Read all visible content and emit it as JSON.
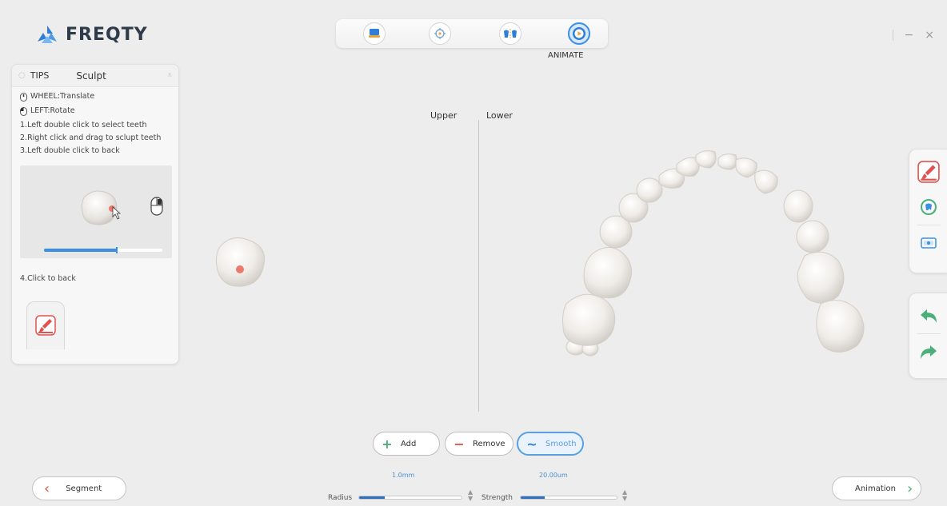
{
  "brand": {
    "name": "FREQTY",
    "color": "#2f7fd8"
  },
  "modebar": {
    "modes": [
      {
        "name": "scan-mode",
        "icon": "scanner-icon",
        "active": false
      },
      {
        "name": "align-mode",
        "icon": "target-icon",
        "active": false
      },
      {
        "name": "compare-mode",
        "icon": "teeth-split-icon",
        "active": false
      },
      {
        "name": "animate-mode",
        "icon": "play-icon",
        "active": true
      }
    ],
    "active_label": "ANIMATE"
  },
  "window": {
    "minimize": "−",
    "close": "×"
  },
  "tips": {
    "header_label": "TIPS",
    "mode_title": "Sculpt",
    "wheel": "WHEEL:Translate",
    "left": "LEFT:Rotate",
    "step1": "1.Left double click to select teeth",
    "step2": "2.Right click and drag to sclupt teeth",
    "step3": "3.Left double click to back",
    "step4": "4.Click to back"
  },
  "viewport": {
    "upper_label": "Upper",
    "lower_label": "Lower"
  },
  "sculpt": {
    "add_label": "Add",
    "remove_label": "Remove",
    "smooth_label": "Smooth",
    "radius_label": "Radius",
    "radius_value": "1.0mm",
    "radius_fraction": 0.25,
    "strength_label": "Strength",
    "strength_value": "20.00um",
    "strength_fraction": 0.25
  },
  "nav": {
    "back_label": "Segment",
    "next_label": "Animation"
  },
  "colors": {
    "accent": "#3a8ee6",
    "sculpt_red": "#e0524f",
    "green": "#4caf7a"
  }
}
